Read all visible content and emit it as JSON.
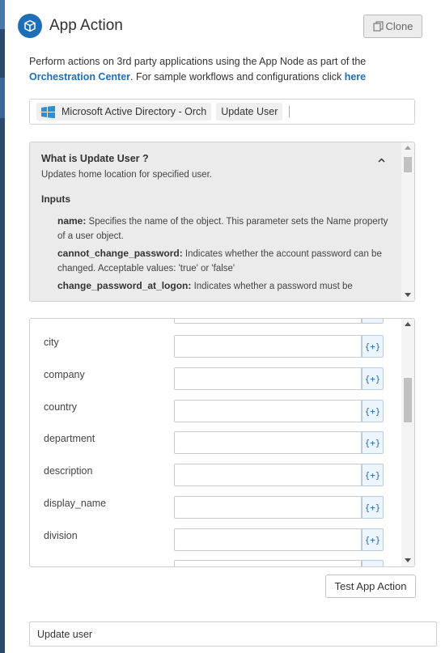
{
  "header": {
    "title": "App Action",
    "icon": "cube-icon",
    "clone_label": "Clone"
  },
  "description": {
    "line1": "Perform actions on 3rd party applications using the App Node as part of the",
    "link1": "Orchestration Center",
    "middle": ". For sample workflows and configurations click ",
    "link2": "here"
  },
  "selector": {
    "app_name": "Microsoft Active Directory - Orch",
    "action_name": "Update User"
  },
  "info": {
    "title": "What is Update User ?",
    "summary": "Updates home location for specified user.",
    "inputs_heading": "Inputs",
    "params": [
      {
        "name": "name:",
        "text": " Specifies the name of the object. This parameter sets the Name property of a user object."
      },
      {
        "name": "cannot_change_password:",
        "text": " Indicates whether the account password can be changed. Acceptable values: 'true' or 'false'"
      },
      {
        "name": "change_password_at_logon:",
        "text": " Indicates whether a password must be"
      }
    ]
  },
  "fields": [
    {
      "label": "city",
      "value": ""
    },
    {
      "label": "company",
      "value": ""
    },
    {
      "label": "country",
      "value": ""
    },
    {
      "label": "department",
      "value": ""
    },
    {
      "label": "description",
      "value": ""
    },
    {
      "label": "display_name",
      "value": ""
    },
    {
      "label": "division",
      "value": ""
    }
  ],
  "variable_button_label": "{+}",
  "test_button_label": "Test App Action",
  "node_name_value": "Update user",
  "colors": {
    "accent": "#1f6fb8",
    "info_bg": "#ebebeb",
    "left_strip": "#2b4a6b"
  }
}
